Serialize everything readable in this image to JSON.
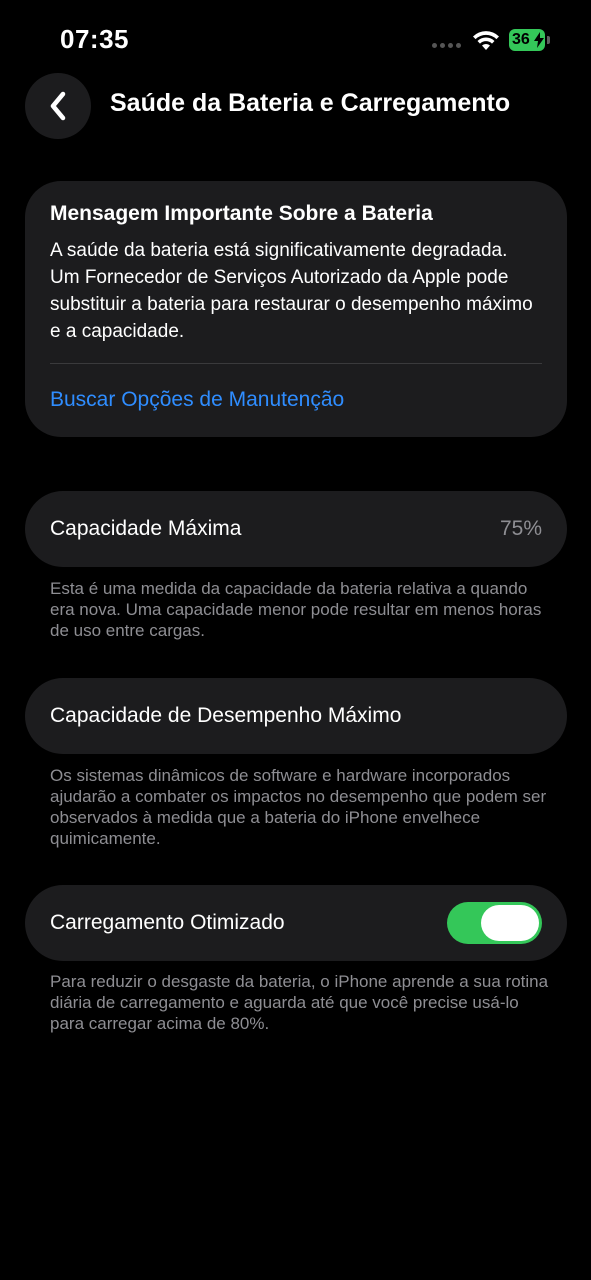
{
  "status_bar": {
    "time": "07:35",
    "battery_level": "36"
  },
  "header": {
    "title": "Saúde da Bateria e Carregamento"
  },
  "important_message": {
    "title": "Mensagem Importante Sobre a Bateria",
    "body": "A saúde da bateria está significativamente degradada. Um Fornecedor de Serviços Autorizado da Apple pode substituir a bateria para restaurar o desempenho máximo e a capacidade.",
    "link_label": "Buscar Opções de Manutenção"
  },
  "max_capacity": {
    "label": "Capacidade Máxima",
    "value": "75%",
    "footnote": "Esta é uma medida da capacidade da bateria relativa a quando era nova. Uma capacidade menor pode resultar em menos horas de uso entre cargas."
  },
  "peak_performance": {
    "label": "Capacidade de Desempenho Máximo",
    "footnote": "Os sistemas dinâmicos de software e hardware incorporados ajudarão a combater os impactos no desempenho que podem ser observados à medida que a bateria do iPhone envelhece quimicamente."
  },
  "optimized_charging": {
    "label": "Carregamento Otimizado",
    "enabled": true,
    "footnote": "Para reduzir o desgaste da bateria, o iPhone aprende a sua rotina diária de carregamento e aguarda até que você precise usá-lo para carregar acima de 80%."
  },
  "colors": {
    "background": "#000000",
    "card": "#1c1c1e",
    "link": "#2f8dff",
    "toggle_on": "#34c759",
    "secondary_text": "#8e8e93"
  },
  "icons": {
    "back": "chevron-left-icon",
    "wifi": "wifi-icon",
    "battery": "battery-charging-icon",
    "signal": "cellular-signal-icon"
  }
}
